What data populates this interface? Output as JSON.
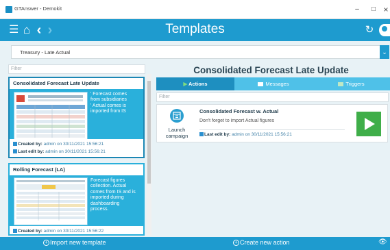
{
  "window": {
    "app_title": "GTAnswer - Demokit",
    "minimize": "–",
    "maximize": "□",
    "close": "×"
  },
  "header": {
    "title": "Templates",
    "menu_icon": "☰",
    "home_icon": "⌂",
    "back_icon": "‹",
    "forward_icon": "›",
    "refresh_icon": "↻"
  },
  "selector": {
    "value": "Treasury - Late Actual",
    "arrow": "⌄"
  },
  "left": {
    "filter_placeholder": "Filter",
    "templates": [
      {
        "name": "Consolidated Forecast Late Update",
        "description_lines": [
          "' Forecast comes",
          "from subsidiaries",
          "' Actual comes is",
          "imported from IS"
        ],
        "created_label": "Created by:",
        "created_value": "admin on 30/11/2021 15:56:21",
        "edited_label": "Last edit by:",
        "edited_value": "admin on 30/11/2021 15:56:21"
      },
      {
        "name": "Rolling Forecast (LA)",
        "description_lines": [
          "Forecast figures",
          "collection. Actual",
          "comes from IS and is",
          "imported during",
          "dashboarding",
          "process."
        ],
        "created_label": "Created by:",
        "created_value": "admin on 30/11/2021 15:56:22"
      }
    ]
  },
  "right": {
    "title": "Consolidated Forecast Late Update",
    "tabs": [
      {
        "label": "Actions",
        "active": true
      },
      {
        "label": "Messages",
        "active": false
      },
      {
        "label": "Triggers",
        "active": false
      }
    ],
    "filter_placeholder": "Filter",
    "action": {
      "launch_label_line1": "Launch",
      "launch_label_line2": "campaign",
      "name": "Consolidated Forecast w. Actual",
      "description": "Don't forget to import Actual figures",
      "edited_label": "Last edit by:",
      "edited_value": "admin on 30/11/2021 15:56:21"
    }
  },
  "bottom": {
    "import_label": "Import new template",
    "create_label": "Create new action",
    "eye_icon": "👁"
  },
  "colors": {
    "accent": "#1e9bcf",
    "card": "#2ab0db",
    "play": "#3fae49"
  }
}
